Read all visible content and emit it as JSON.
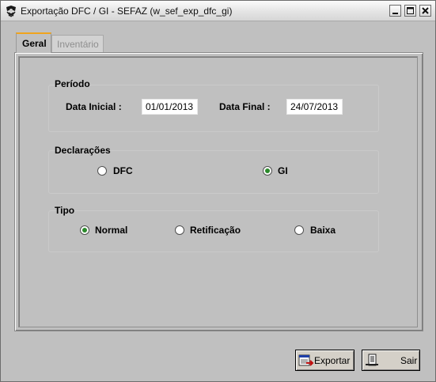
{
  "window": {
    "title": "Exportação DFC / GI - SEFAZ (w_sef_exp_dfc_gi)",
    "buttons": [
      "minimize",
      "maximize",
      "close"
    ]
  },
  "tabs": [
    {
      "label": "Geral",
      "active": true
    },
    {
      "label": "Inventário",
      "active": false
    }
  ],
  "periodo": {
    "title": "Período",
    "data_inicial_label": "Data Inicial  :",
    "data_inicial_value": "01/01/2013",
    "data_final_label": "Data Final :",
    "data_final_value": "24/07/2013"
  },
  "declaracoes": {
    "title": "Declarações",
    "options": [
      {
        "label": "DFC",
        "selected": false
      },
      {
        "label": "GI",
        "selected": true
      }
    ]
  },
  "tipo": {
    "title": "Tipo",
    "options": [
      {
        "label": "Normal",
        "selected": true
      },
      {
        "label": "Retificação",
        "selected": false
      },
      {
        "label": "Baixa",
        "selected": false
      }
    ]
  },
  "actions": {
    "export_label": "Exportar",
    "exit_label": "Sair"
  },
  "colors": {
    "window_bg": "#c0c0c0",
    "active_tab_accent": "#f0a41d",
    "radio_dot": "#2b8a2b"
  }
}
